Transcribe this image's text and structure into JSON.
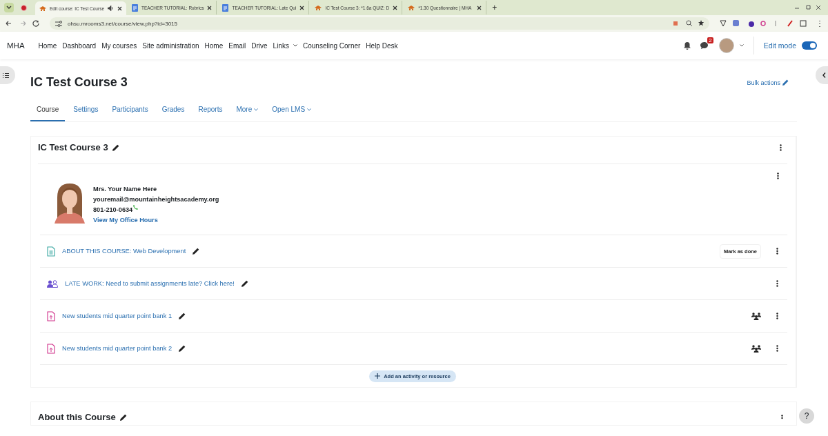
{
  "browser": {
    "tabs": [
      {
        "title": "Edit course: IC Test Course",
        "kind": "moodle",
        "selected": true,
        "audio": true
      },
      {
        "title": "TEACHER TUTORIAL: Rubrics",
        "kind": "doc",
        "selected": false,
        "audio": false
      },
      {
        "title": "TEACHER TUTORIAL: Late Qui",
        "kind": "doc",
        "selected": false,
        "audio": false
      },
      {
        "title": "IC Test Course 3: *1.6a QUIZ: D",
        "kind": "moodle",
        "selected": false,
        "audio": false
      },
      {
        "title": "*1.30 Questionnaire | MHA",
        "kind": "moodle",
        "selected": false,
        "audio": false
      }
    ],
    "new_tab": "+",
    "url": "ohsu.mrooms3.net/course/view.php?id=3015"
  },
  "navbar": {
    "brand": "MHA",
    "items": [
      {
        "label": "Home",
        "dropdown": false
      },
      {
        "label": "Dashboard",
        "dropdown": false
      },
      {
        "label": "My courses",
        "dropdown": false
      },
      {
        "label": "Site administration",
        "dropdown": false
      },
      {
        "label": "Home",
        "dropdown": false
      },
      {
        "label": "Email",
        "dropdown": false
      },
      {
        "label": "Drive",
        "dropdown": false
      },
      {
        "label": "Links",
        "dropdown": true
      },
      {
        "label": "Counseling Corner",
        "dropdown": false
      },
      {
        "label": "Help Desk",
        "dropdown": false
      }
    ],
    "message_count": "2",
    "edit_mode": {
      "label": "Edit mode",
      "on": true
    }
  },
  "course": {
    "title": "IC Test Course 3",
    "bulk_actions": "Bulk actions",
    "tabs": [
      {
        "label": "Course",
        "selected": true,
        "dropdown": false
      },
      {
        "label": "Settings",
        "selected": false,
        "dropdown": false
      },
      {
        "label": "Participants",
        "selected": false,
        "dropdown": false
      },
      {
        "label": "Grades",
        "selected": false,
        "dropdown": false
      },
      {
        "label": "Reports",
        "selected": false,
        "dropdown": false
      },
      {
        "label": "More",
        "selected": false,
        "dropdown": true
      },
      {
        "label": "Open LMS",
        "selected": false,
        "dropdown": true
      }
    ]
  },
  "section": {
    "title": "IC Test Course 3",
    "teacher": {
      "name": "Mrs. Your Name Here",
      "email": "youremail@mountainheightsacademy.org",
      "phone": "801-210-0634",
      "office_hours": "View My Office Hours"
    },
    "activities": [
      {
        "kind": "page",
        "title": "ABOUT THIS COURSE: Web Development",
        "completion": "Mark as done",
        "group_mode": false
      },
      {
        "kind": "forum",
        "title": "LATE WORK: Need to submit assignments late? Click here!",
        "group_mode": false
      },
      {
        "kind": "assign",
        "title": "New students mid quarter point bank 1",
        "group_mode": true
      },
      {
        "kind": "assign",
        "title": "New students mid quarter point bank 2",
        "group_mode": true
      }
    ],
    "add_activity": "Add an activity or resource"
  },
  "next_section": {
    "title": "About this Course"
  },
  "help": "?"
}
